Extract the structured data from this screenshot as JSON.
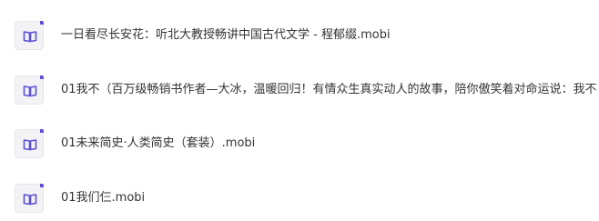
{
  "colors": {
    "icon_accent": "#5b4fd6",
    "icon_bg": "#f3f3f6",
    "text": "#333333"
  },
  "files": [
    {
      "icon": "book-icon",
      "name": "一日看尽长安花：听北大教授畅讲中国古代文学 - 程郁缀.mobi"
    },
    {
      "icon": "book-icon",
      "name": "01我不（百万级畅销书作者—大冰，温暖回归！有情众生真实动人的故事，陪你傲笑着对命运说：我不"
    },
    {
      "icon": "book-icon",
      "name": "01未来简史·人类简史（套装）.mobi"
    },
    {
      "icon": "book-icon",
      "name": "01我们仨.mobi"
    }
  ]
}
